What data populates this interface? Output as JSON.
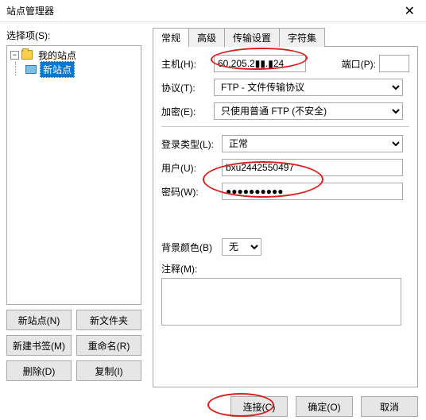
{
  "window": {
    "title": "站点管理器",
    "close": "✕"
  },
  "left": {
    "label": "选择项(S):",
    "root": "我的站点",
    "child": "新站点",
    "buttons": {
      "newsite": "新站点(N)",
      "newfolder": "新文件夹",
      "newbookmark": "新建书签(M)",
      "rename": "重命名(R)",
      "delete": "删除(D)",
      "copy": "复制(I)"
    }
  },
  "tabs": {
    "general": "常规",
    "advanced": "高级",
    "transfer": "传输设置",
    "charset": "字符集"
  },
  "form": {
    "hostLabel": "主机(H):",
    "hostValue": "60.205.2▮▮.▮24",
    "portLabel": "端口(P):",
    "portValue": "",
    "protoLabel": "协议(T):",
    "protoValue": "FTP - 文件传输协议",
    "encLabel": "加密(E):",
    "encValue": "只使用普通 FTP (不安全)",
    "loginLabel": "登录类型(L):",
    "loginValue": "正常",
    "userLabel": "用户(U):",
    "userValue": "bxu2442550497",
    "passLabel": "密码(W):",
    "passValue": "●●●●●●●●●●",
    "bgLabel": "背景颜色(B)",
    "bgValue": "无",
    "commentLabel": "注释(M):"
  },
  "footer": {
    "connect": "连接(C)",
    "ok": "确定(O)",
    "cancel": "取消"
  }
}
